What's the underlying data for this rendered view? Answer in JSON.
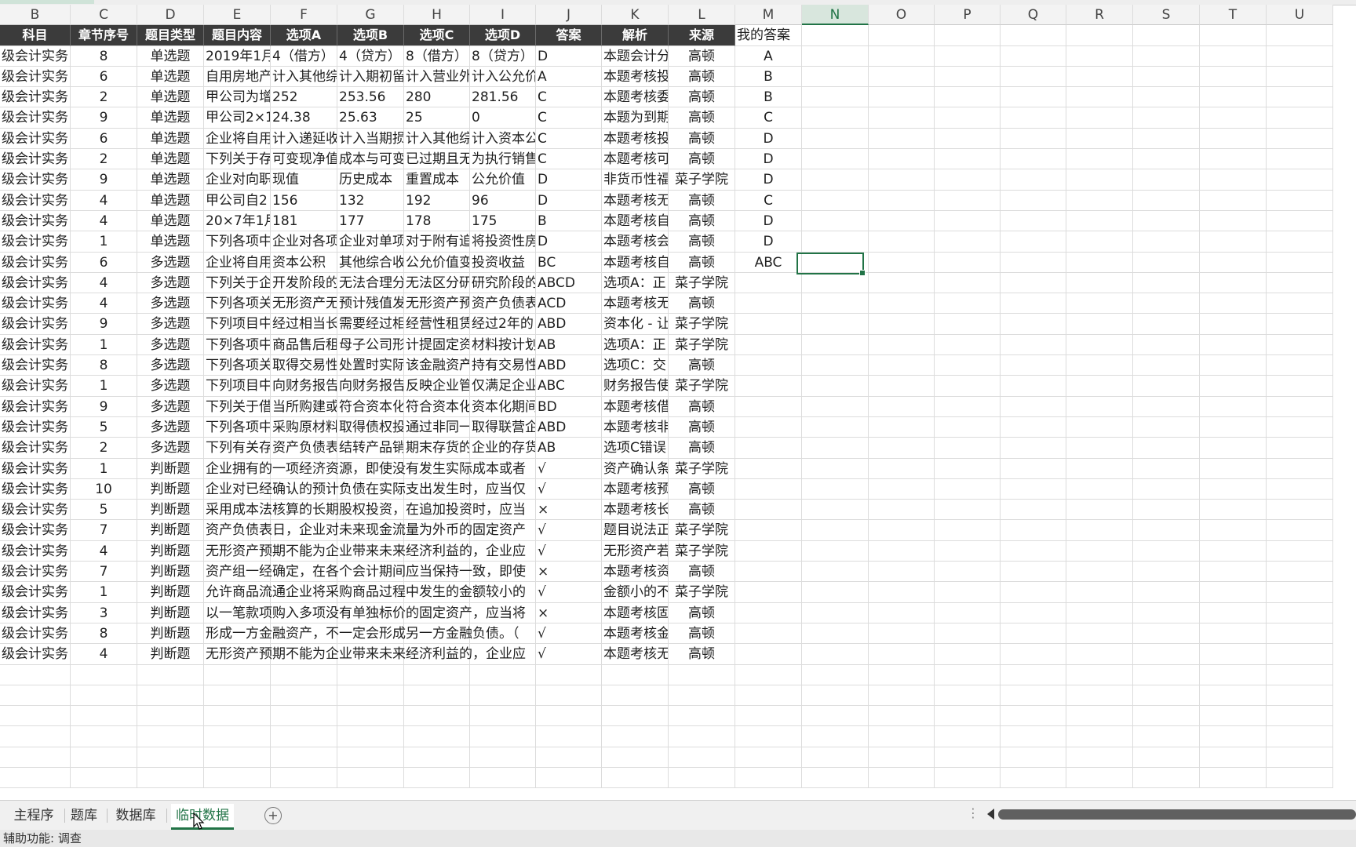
{
  "columns": [
    "B",
    "C",
    "D",
    "E",
    "F",
    "G",
    "H",
    "I",
    "J",
    "K",
    "L",
    "M",
    "N",
    "O",
    "P",
    "Q",
    "R",
    "S",
    "T",
    "U"
  ],
  "active_column": "N",
  "headers": [
    "科目",
    "章节序号",
    "题目类型",
    "题目内容",
    "选项A",
    "选项B",
    "选项C",
    "选项D",
    "答案",
    "解析",
    "来源",
    "我的答案"
  ],
  "rows": [
    [
      "级会计实务",
      "8",
      "单选题",
      "2019年1月",
      "4（借方）",
      "4（贷方）",
      "8（借方）",
      "8（贷方）",
      "D",
      "本题会计分",
      "高顿",
      "A"
    ],
    [
      "级会计实务",
      "6",
      "单选题",
      "自用房地产",
      "计入其他综",
      "计入期初留",
      "计入营业外",
      "计入公允价",
      "A",
      "本题考核投",
      "高顿",
      "B"
    ],
    [
      "级会计实务",
      "2",
      "单选题",
      "甲公司为增",
      "252",
      "253.56",
      "280",
      "281.56",
      "C",
      "本题考核委",
      "高顿",
      "B"
    ],
    [
      "级会计实务",
      "9",
      "单选题",
      "甲公司2×1",
      "24.38",
      "25.63",
      "25",
      "0",
      "C",
      "本题为到期",
      "高顿",
      "C"
    ],
    [
      "级会计实务",
      "6",
      "单选题",
      "企业将自用",
      "计入递延收",
      "计入当期损",
      "计入其他综",
      "计入资本公",
      "C",
      "本题考核投",
      "高顿",
      "D"
    ],
    [
      "级会计实务",
      "2",
      "单选题",
      "下列关于存",
      "可变现净值",
      "成本与可变",
      "已过期且无",
      "为执行销售",
      "C",
      "本题考核可",
      "高顿",
      "D"
    ],
    [
      "级会计实务",
      "9",
      "单选题",
      "企业对向职",
      "现值",
      "历史成本",
      "重置成本",
      "公允价值",
      "D",
      "非货币性福",
      "菜子学院",
      "D"
    ],
    [
      "级会计实务",
      "4",
      "单选题",
      "甲公司自2",
      "156",
      "132",
      "192",
      "96",
      "D",
      "本题考核无",
      "高顿",
      "C"
    ],
    [
      "级会计实务",
      "4",
      "单选题",
      "20×7年1月",
      "181",
      "177",
      "178",
      "175",
      "B",
      "本题考核自",
      "高顿",
      "D"
    ],
    [
      "级会计实务",
      "1",
      "单选题",
      "下列各项中",
      "企业对各项",
      "企业对单项",
      "对于附有追",
      "将投资性房",
      "D",
      "本题考核会",
      "高顿",
      "D"
    ],
    [
      "级会计实务",
      "6",
      "多选题",
      "企业将自用",
      "资本公积",
      "其他综合收",
      "公允价值变",
      "投资收益",
      "BC",
      "本题考核自",
      "高顿",
      "ABC"
    ],
    [
      "级会计实务",
      "4",
      "多选题",
      "下列关于企",
      "开发阶段的",
      "无法合理分",
      "无法区分研",
      "研究阶段的",
      "ABCD",
      "选项A：正",
      "菜子学院",
      ""
    ],
    [
      "级会计实务",
      "4",
      "多选题",
      "下列各项关",
      "无形资产无",
      "预计残值发",
      "无形资产预",
      "资产负债表",
      "ACD",
      "本题考核无",
      "高顿",
      ""
    ],
    [
      "级会计实务",
      "9",
      "多选题",
      "下列项目中",
      "经过相当长",
      "需要经过相",
      "经营性租赁",
      "经过2年的",
      "ABD",
      "资本化 - 让",
      "菜子学院",
      ""
    ],
    [
      "级会计实务",
      "1",
      "多选题",
      "下列各项中",
      "商品售后租",
      "母子公司形",
      "计提固定资",
      "材料按计划",
      "AB",
      "选项A：正",
      "菜子学院",
      ""
    ],
    [
      "级会计实务",
      "8",
      "多选题",
      "下列各项关",
      "取得交易性",
      "处置时实际",
      "该金融资产",
      "持有交易性",
      "ABD",
      "选项C：交",
      "高顿",
      ""
    ],
    [
      "级会计实务",
      "1",
      "多选题",
      "下列项目中",
      "向财务报告",
      "向财务报告",
      "反映企业管",
      "仅满足企业",
      "ABC",
      "财务报告使",
      "菜子学院",
      ""
    ],
    [
      "级会计实务",
      "9",
      "多选题",
      "下列关于借",
      "当所购建或",
      "符合资本化",
      "符合资本化",
      "资本化期间",
      "BD",
      "本题考核借",
      "高顿",
      ""
    ],
    [
      "级会计实务",
      "5",
      "多选题",
      "下列各项中",
      "采购原材料",
      "取得债权投",
      "通过非同一",
      "取得联营企",
      "ABD",
      "本题考核非",
      "高顿",
      ""
    ],
    [
      "级会计实务",
      "2",
      "多选题",
      "下列有关存",
      "资产负债表",
      "结转产品销",
      "期末存货的",
      "企业的存货",
      "AB",
      "选项C错误",
      "高顿",
      ""
    ],
    [
      "级会计实务",
      "1",
      "判断题",
      "企业拥有的一项经济资源，即使没有发生实际成本或者",
      "",
      "",
      "",
      "",
      "√",
      "资产确认条",
      "菜子学院",
      ""
    ],
    [
      "级会计实务",
      "10",
      "判断题",
      "企业对已经确认的预计负债在实际支出发生时，应当仅",
      "",
      "",
      "",
      "",
      "√",
      "本题考核预",
      "高顿",
      ""
    ],
    [
      "级会计实务",
      "5",
      "判断题",
      "采用成本法核算的长期股权投资，在追加投资时，应当",
      "",
      "",
      "",
      "",
      "×",
      "本题考核长",
      "高顿",
      ""
    ],
    [
      "级会计实务",
      "7",
      "判断题",
      "资产负债表日，企业对未来现金流量为外币的固定资产",
      "",
      "",
      "",
      "",
      "√",
      "题目说法正",
      "菜子学院",
      ""
    ],
    [
      "级会计实务",
      "4",
      "判断题",
      "无形资产预期不能为企业带来未来经济利益的，企业应",
      "",
      "",
      "",
      "",
      "√",
      "无形资产若",
      "菜子学院",
      ""
    ],
    [
      "级会计实务",
      "7",
      "判断题",
      "资产组一经确定，在各个会计期间应当保持一致，即使",
      "",
      "",
      "",
      "",
      "×",
      "本题考核资",
      "高顿",
      ""
    ],
    [
      "级会计实务",
      "1",
      "判断题",
      "允许商品流通企业将采购商品过程中发生的金额较小的",
      "",
      "",
      "",
      "",
      "√",
      "金额小的不",
      "菜子学院",
      ""
    ],
    [
      "级会计实务",
      "3",
      "判断题",
      "以一笔款项购入多项没有单独标价的固定资产，应当将",
      "",
      "",
      "",
      "",
      "×",
      "本题考核固",
      "高顿",
      ""
    ],
    [
      "级会计实务",
      "8",
      "判断题",
      "形成一方金融资产，不一定会形成另一方金融负债。（",
      "",
      "",
      "",
      "",
      "√",
      "本题考核金",
      "高顿",
      ""
    ],
    [
      "级会计实务",
      "4",
      "判断题",
      "无形资产预期不能为企业带来未来经济利益的，企业应",
      "",
      "",
      "",
      "",
      "√",
      "本题考核无",
      "高顿",
      ""
    ]
  ],
  "sheet_tabs": [
    "主程序",
    "题库",
    "数据库",
    "临时数据"
  ],
  "active_tab": "临时数据",
  "add_tab_icon": "+",
  "status_text": "辅助功能: 调查",
  "colors": {
    "accent": "#217346",
    "header_bg": "#3b3b3b"
  }
}
